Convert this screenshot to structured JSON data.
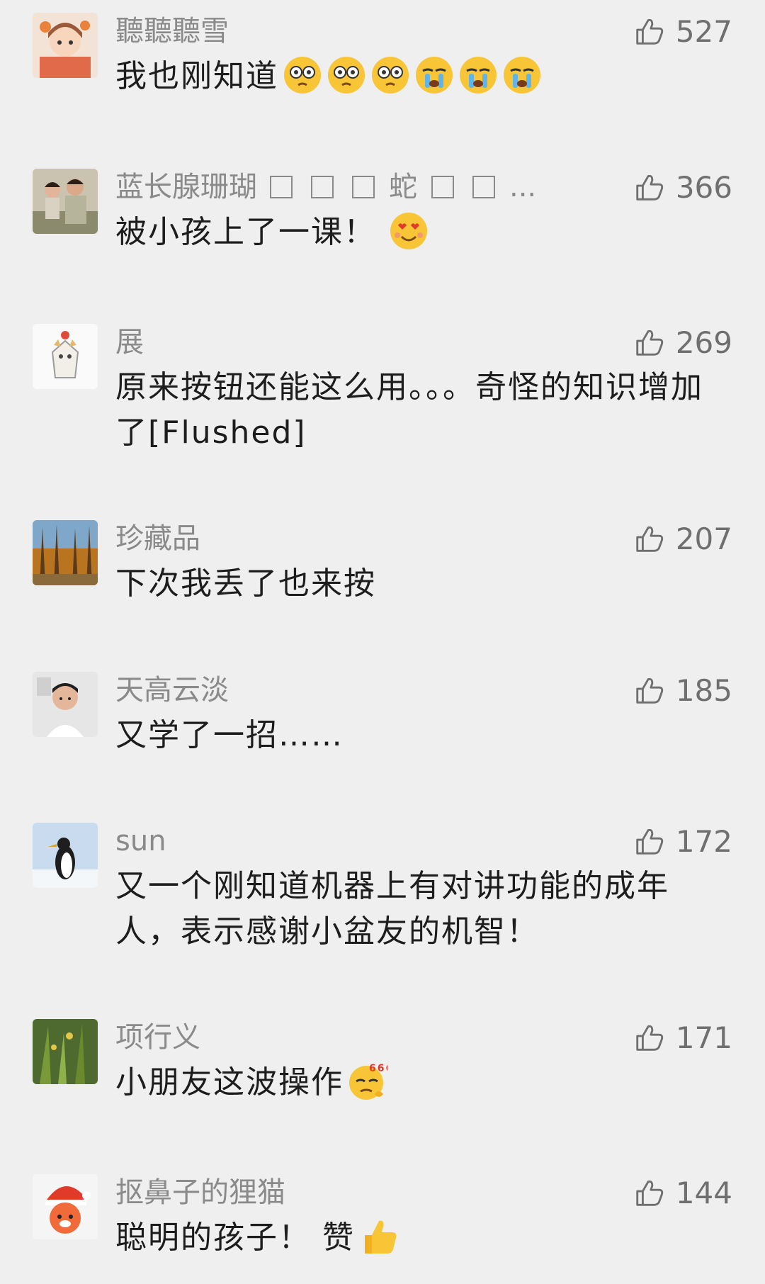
{
  "comments": [
    {
      "name": "聽聽聽雪",
      "likes": "527",
      "text": "我也刚知道"
    },
    {
      "name_parts": [
        "蓝长腺珊瑚",
        "蛇",
        "..."
      ],
      "likes": "366",
      "text": "被小孩上了一课！"
    },
    {
      "name": "展",
      "likes": "269",
      "text": "原来按钮还能这么用。。。奇怪的知识增加了[Flushed]"
    },
    {
      "name": "珍藏品",
      "likes": "207",
      "text": "下次我丢了也来按"
    },
    {
      "name": "天高云淡",
      "likes": "185",
      "text": "又学了一招……"
    },
    {
      "name": "sun",
      "likes": "172",
      "text": "又一个刚知道机器上有对讲功能的成年人，表示感谢小盆友的机智！"
    },
    {
      "name": "项行义",
      "likes": "171",
      "text": "小朋友这波操作",
      "emoji_label": "666"
    },
    {
      "name": "抠鼻子的狸猫",
      "likes": "144",
      "text": "聪明的孩子！ 赞"
    }
  ],
  "colors": {
    "background": "#efefef",
    "name": "#8a8a8a",
    "text": "#1d1d1d",
    "like": "#6f6f6f",
    "emoji_yellow": "#f7c536"
  },
  "icons": {
    "like": "thumbs-up-icon"
  }
}
